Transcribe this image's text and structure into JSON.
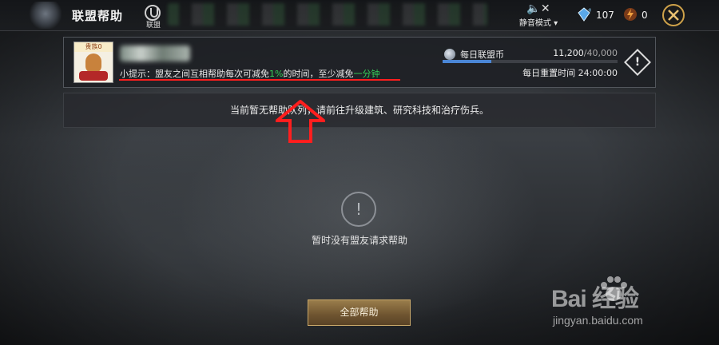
{
  "header": {
    "title": "联盟帮助",
    "alliance_label": "联盟",
    "mute_label": "静音模式",
    "gems": "107",
    "energy": "0"
  },
  "info_panel": {
    "avatar_badge": "贵族0",
    "tip_prefix": "小提示：盟友之间互相帮助每次可减免",
    "tip_percent": "1%",
    "tip_middle": "的时间，至少减免",
    "tip_minimum": "一分钟",
    "coin_label": "每日联盟币",
    "coin_current": "11,200",
    "coin_max": "/40,000",
    "coin_progress": 0.28,
    "reset_text": "每日重置时间 24:00:00"
  },
  "queue_notice": "当前暂无帮助队列，请前往升级建筑、研究科技和治疗伤兵。",
  "empty_state": {
    "message": "暂时没有盟友请求帮助"
  },
  "actions": {
    "help_all_label": "全部帮助"
  },
  "watermark": {
    "text": "Bai 经验",
    "url": "jingyan.baidu.com"
  },
  "colors": {
    "highlight_green": "#34d058",
    "annotation_red": "#ff1e1e",
    "progress_blue": "#4a86d6",
    "button_gold": "#9a7d4b"
  }
}
